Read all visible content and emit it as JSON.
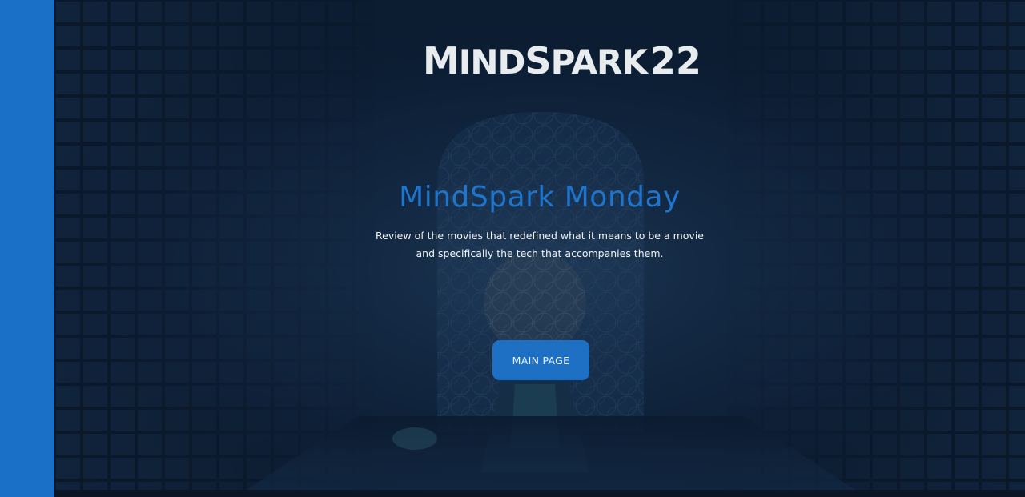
{
  "logo": {
    "word_first": "M",
    "word_rest": "IND",
    "word_second_first": "S",
    "word_second_rest": "PARK",
    "number": "22",
    "bolt_icon": "lightning-bolt-icon"
  },
  "hero": {
    "title": "MindSpark Monday",
    "subtitle_line1": "Review of the movies that redefined what it means to be a movie",
    "subtitle_line2": "and specifically the tech that accompanies them.",
    "button_label": "MAIN PAGE"
  },
  "colors": {
    "accent": "#1a70c6",
    "title": "#1f74cc",
    "background": "#0e2138",
    "text_light": "#f1f3f5"
  }
}
